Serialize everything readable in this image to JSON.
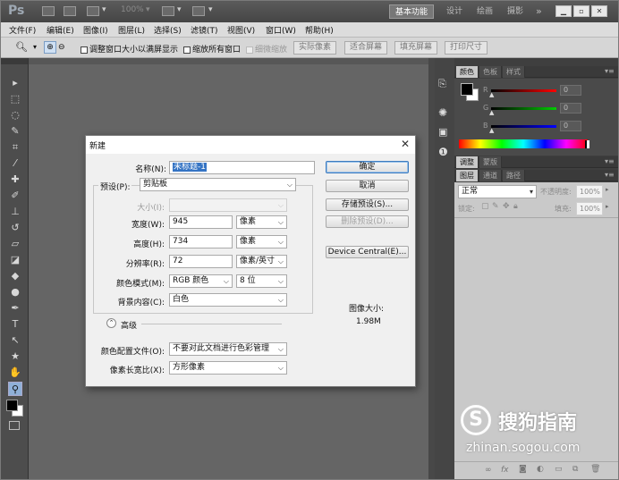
{
  "app": {
    "logo": "Ps",
    "zoom": "100%"
  },
  "workspaces": [
    "基本功能",
    "设计",
    "绘画",
    "摄影",
    "»"
  ],
  "menu": [
    "文件(F)",
    "编辑(E)",
    "图像(I)",
    "图层(L)",
    "选择(S)",
    "滤镜(T)",
    "视图(V)",
    "窗口(W)",
    "帮助(H)"
  ],
  "options": {
    "resize_windows": "调整窗口大小以满屏显示",
    "zoom_all": "缩放所有窗口",
    "scrubby_zoom": "细微缩放",
    "actual_pixels": "实际像素",
    "fit_screen": "适合屏幕",
    "fill_screen": "填充屏幕",
    "print_size": "打印尺寸"
  },
  "panels": {
    "color_tabs": [
      "颜色",
      "色板",
      "样式"
    ],
    "channels": [
      {
        "label": "R",
        "value": "0",
        "color": "#ff0000"
      },
      {
        "label": "G",
        "value": "0",
        "color": "#00c000"
      },
      {
        "label": "B",
        "value": "0",
        "color": "#0000ff"
      }
    ],
    "adjust_tabs": [
      "调整",
      "蒙版"
    ],
    "layer_tabs": [
      "图层",
      "通道",
      "路径"
    ],
    "blend_mode": "正常",
    "opacity_label": "不透明度:",
    "opacity": "100%",
    "lock_label": "锁定:",
    "fill_label": "填充:",
    "fill": "100%"
  },
  "dialog": {
    "title": "新建",
    "name_label": "名称(N):",
    "name_value": "未标题-1",
    "preset_label": "预设(P):",
    "preset_value": "剪贴板",
    "size_label": "大小(I):",
    "width_label": "宽度(W):",
    "width_value": "945",
    "width_unit": "像素",
    "height_label": "高度(H):",
    "height_value": "734",
    "height_unit": "像素",
    "resolution_label": "分辨率(R):",
    "resolution_value": "72",
    "resolution_unit": "像素/英寸",
    "color_mode_label": "颜色模式(M):",
    "color_mode_value": "RGB 颜色",
    "bit_depth": "8 位",
    "background_label": "背景内容(C):",
    "background_value": "白色",
    "advanced_label": "高级",
    "color_profile_label": "颜色配置文件(O):",
    "color_profile_value": "不要对此文档进行色彩管理",
    "pixel_aspect_label": "像素长宽比(X):",
    "pixel_aspect_value": "方形像素",
    "ok": "确定",
    "cancel": "取消",
    "save_preset": "存储预设(S)...",
    "delete_preset": "删除预设(D)...",
    "device_central": "Device Central(E)...",
    "image_size_label": "图像大小:",
    "image_size_value": "1.98M"
  },
  "watermark": {
    "brand": "搜狗指南",
    "url": "zhinan.sogou.com"
  }
}
